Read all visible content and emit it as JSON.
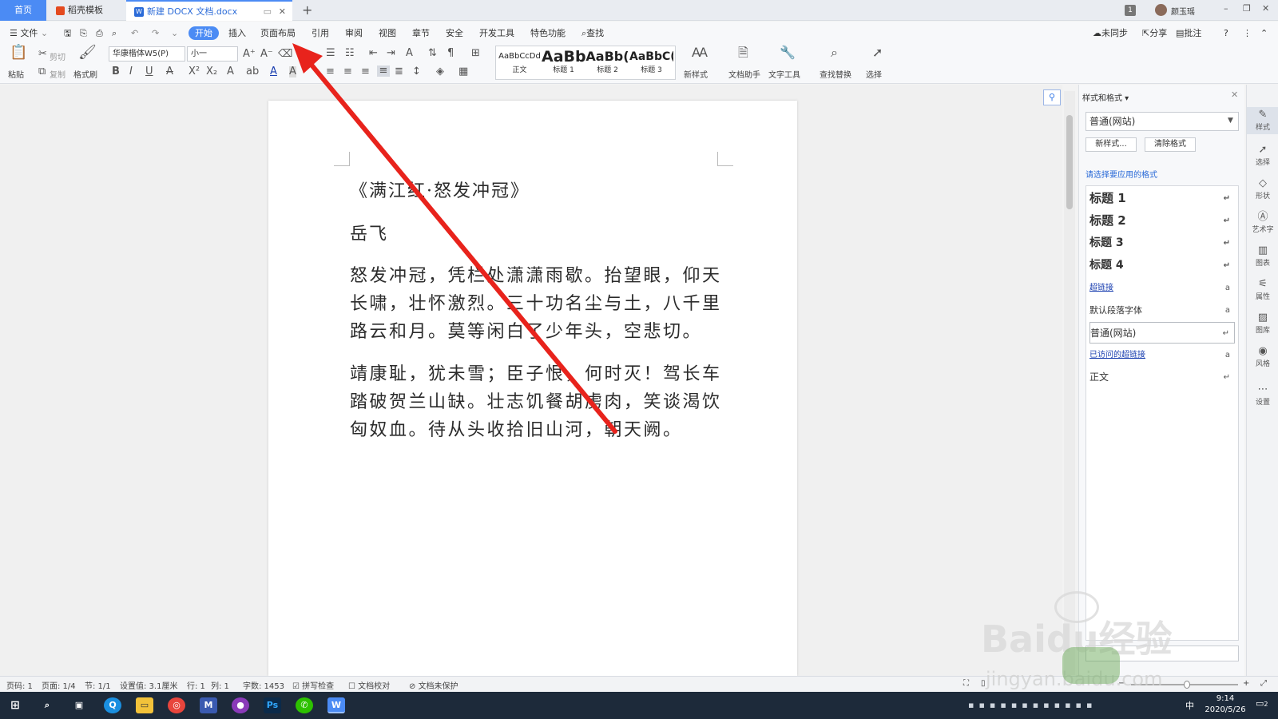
{
  "tabs": {
    "home": "首页",
    "docer": "稻壳模板",
    "doc": "新建 DOCX 文档.docx",
    "new_tab": "+"
  },
  "title_right": {
    "badge": "1",
    "user": "颜玉瑶",
    "minimize": "–",
    "restore": "❐",
    "close": "✕"
  },
  "menu": {
    "file": "文件",
    "items": [
      "开始",
      "插入",
      "页面布局",
      "引用",
      "审阅",
      "视图",
      "章节",
      "安全",
      "开发工具",
      "特色功能"
    ],
    "search": "查找",
    "right": [
      "未同步",
      "分享",
      "批注"
    ]
  },
  "ribbon": {
    "paste": "粘贴",
    "cut": "剪切",
    "copy": "复制",
    "format_painter": "格式刷",
    "font_name": "华康楷体W5(P)",
    "font_size": "小一",
    "styles": [
      {
        "sample": "AaBbCcDd",
        "name": "正文"
      },
      {
        "sample": "AaBb",
        "name": "标题 1"
      },
      {
        "sample": "AaBb(",
        "name": "标题 2"
      },
      {
        "sample": "AaBbC(",
        "name": "标题 3"
      }
    ],
    "new_style": "新样式",
    "doc_helper": "文档助手",
    "text_tools": "文字工具",
    "find_replace": "查找替换",
    "select": "选择"
  },
  "document": {
    "title": "《满江红·怒发冲冠》",
    "author": "岳飞",
    "paragraphs": [
      "怒发冲冠，凭栏处潇潇雨歇。抬望眼，仰天长啸，壮怀激烈。三十功名尘与土，八千里路云和月。莫等闲白了少年头，空悲切。",
      "靖康耻，犹未雪；臣子恨，何时灭！驾长车踏破贺兰山缺。壮志饥餐胡虏肉，笑谈渴饮匈奴血。待从头收拾旧山河，朝天阙。"
    ]
  },
  "panel": {
    "title": "样式和格式",
    "current_style": "普通(网站)",
    "new_style_btn": "新样式...",
    "clear_btn": "清除格式",
    "hint": "请选择要应用的格式",
    "styles": [
      {
        "label": "标题  1",
        "mark": "↵"
      },
      {
        "label": "标题  2",
        "mark": "↵"
      },
      {
        "label": "标题  3",
        "mark": "↵"
      },
      {
        "label": "标题  4",
        "mark": "↵"
      },
      {
        "label": "超链接",
        "mark": "a"
      },
      {
        "label": "默认段落字体",
        "mark": "a"
      },
      {
        "label": "普通(网站)",
        "mark": "↵"
      },
      {
        "label": "已访问的超链接",
        "mark": "a"
      },
      {
        "label": "正文",
        "mark": "↵"
      }
    ]
  },
  "sidebar": [
    "样式",
    "选择",
    "形状",
    "艺术字",
    "图表",
    "属性",
    "图库",
    "风格",
    "设置"
  ],
  "status": {
    "page": "页码: 1",
    "pages": "页面: 1/4",
    "section": "节: 1/1",
    "setting": "设置值: 3.1厘米",
    "row": "行: 1",
    "col": "列: 1",
    "words": "字数: 1453",
    "spell": "拼写检查",
    "proof": "文档校对",
    "protect": "文档未保护"
  },
  "taskbar": {
    "time": "9:14",
    "date": "2020/5/26",
    "ime": "中",
    "notify": "2"
  },
  "watermark": {
    "text1": "Baidu经验",
    "text2": "jingyan.baidu.com"
  },
  "colors": {
    "accent": "#4b8bf4",
    "arrow": "#e8231c",
    "link": "#1a3fb0"
  }
}
